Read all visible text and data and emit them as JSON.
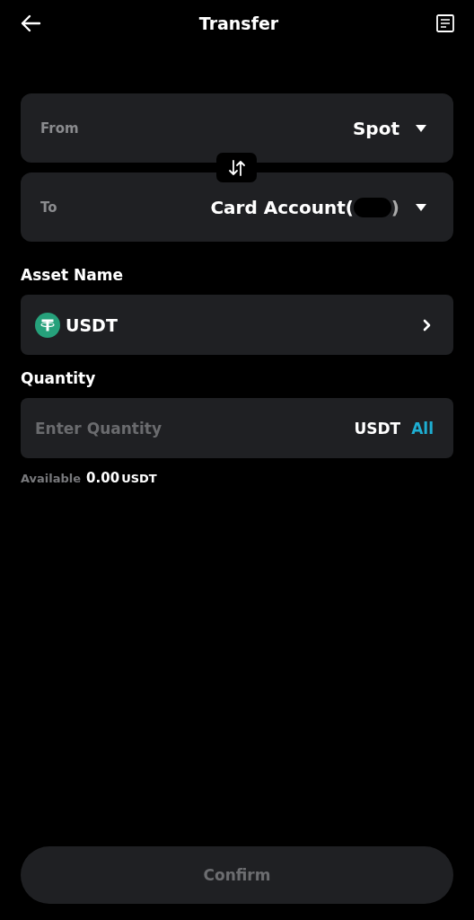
{
  "header": {
    "title": "Transfer"
  },
  "accounts": [
    {
      "label": "From",
      "value": "Spot"
    },
    {
      "label": "To",
      "value": "Card Account(",
      "value_end": ")",
      "redacted": true
    }
  ],
  "asset": {
    "label": "Asset Name",
    "name": "USDT"
  },
  "quantity": {
    "label": "Quantity",
    "placeholder": "Enter Quantity",
    "unit": "USDT",
    "all": "All"
  },
  "available": {
    "label": "Available",
    "amount": "0.00",
    "unit": "USDT"
  },
  "confirm": {
    "label": "Confirm",
    "disabled": true
  }
}
